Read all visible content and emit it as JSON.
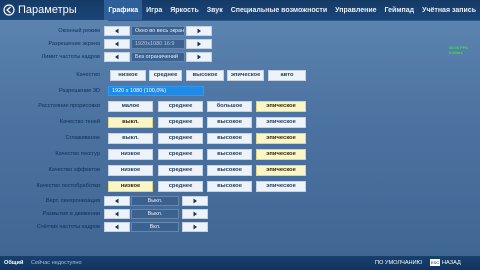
{
  "header": {
    "title": "Параметры",
    "tabs": [
      "Графика",
      "Игра",
      "Яркость",
      "Звук",
      "Специальные возможности",
      "Управление",
      "Геймпад",
      "Учётная запись"
    ]
  },
  "settings": {
    "window_mode": {
      "label": "Оконный режим",
      "value": "Окно во весь экран"
    },
    "resolution": {
      "label": "Разрешение экрана",
      "value": "1920x1080 16:9"
    },
    "fps_limit": {
      "label": "Лимит частоты кадров",
      "value": "Без ограничений"
    },
    "quality": {
      "label": "Качество",
      "options": [
        "низкое",
        "среднее",
        "высокое",
        "эпическое",
        "авто"
      ]
    },
    "res_3d": {
      "label": "Разрешение 3D",
      "value": "1920 x 1080 (100,0%)",
      "percent": 100
    },
    "view_distance": {
      "label": "Расстояние прорисовки",
      "options": [
        "малое",
        "среднее",
        "большое",
        "эпическое"
      ],
      "selected": 3
    },
    "shadows": {
      "label": "Качество теней",
      "options": [
        "выкл.",
        "среднее",
        "высокое",
        "эпическое"
      ],
      "selected": 0
    },
    "anti_aliasing": {
      "label": "Сглаживание",
      "options": [
        "выкл.",
        "среднее",
        "высокое",
        "эпическое"
      ],
      "selected": 3
    },
    "textures": {
      "label": "Качество текстур",
      "options": [
        "низкое",
        "среднее",
        "высокое",
        "эпическое"
      ],
      "selected": 3
    },
    "effects": {
      "label": "Качество эффектов",
      "options": [
        "низкое",
        "среднее",
        "высокое",
        "эпическое"
      ],
      "selected": 3
    },
    "post_processing": {
      "label": "Качество постобработки",
      "options": [
        "низкое",
        "среднее",
        "высокое",
        "эпическое"
      ],
      "selected": 0
    },
    "vsync": {
      "label": "Верт. синхронизация",
      "value": "Выкл."
    },
    "motion_blur": {
      "label": "Размытие в движении",
      "value": "Выкл."
    },
    "fps_counter": {
      "label": "Счётчик частоты кадров",
      "value": "Вкл."
    }
  },
  "fps_overlay": {
    "line1": "60.00 FPS",
    "line2": "6.00ms"
  },
  "footer": {
    "general": "Общий",
    "network": "Сейчас недоступно",
    "reset": "ПО УМОЛЧАНИЮ",
    "back": "НАЗАД"
  },
  "colors": {
    "background": "#4f77a4",
    "topbar": "#18406e",
    "active_tab": "#2f5f98",
    "selected_option": "#fbf6c6",
    "option": "#eef3f9",
    "res_bar": "#1f8be6"
  }
}
